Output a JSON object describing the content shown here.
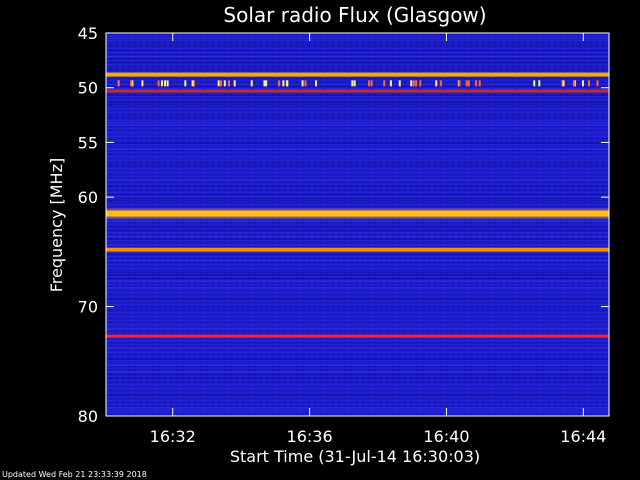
{
  "chart_data": {
    "type": "heatmap",
    "title": "Solar radio Flux (Glasgow)",
    "xlabel": "Start Time (31-Jul-14 16:30:03)",
    "ylabel": "Frequency [MHz]",
    "xlim": [
      "16:30:03",
      "16:44:45"
    ],
    "ylim": [
      45,
      80
    ],
    "y_ticks": [
      45,
      50,
      55,
      60,
      70,
      80
    ],
    "x_ticks": [
      "16:32",
      "16:36",
      "16:40",
      "16:44"
    ],
    "background_color": "#1a1acc",
    "bright_bands": [
      {
        "freq": 48.8,
        "intensity": "high",
        "color": "#ffaa00"
      },
      {
        "freq": 50.3,
        "intensity": "medium",
        "color": "#cc2a2a"
      },
      {
        "freq": 61.5,
        "intensity": "very-high",
        "color": "#ffdd33"
      },
      {
        "freq": 64.8,
        "intensity": "high",
        "color": "#ff8c00"
      },
      {
        "freq": 72.7,
        "intensity": "medium",
        "color": "#ff2222"
      }
    ],
    "grid": false
  },
  "footer": {
    "updated": "Updated Wed Feb 21 23:33:39 2018"
  }
}
